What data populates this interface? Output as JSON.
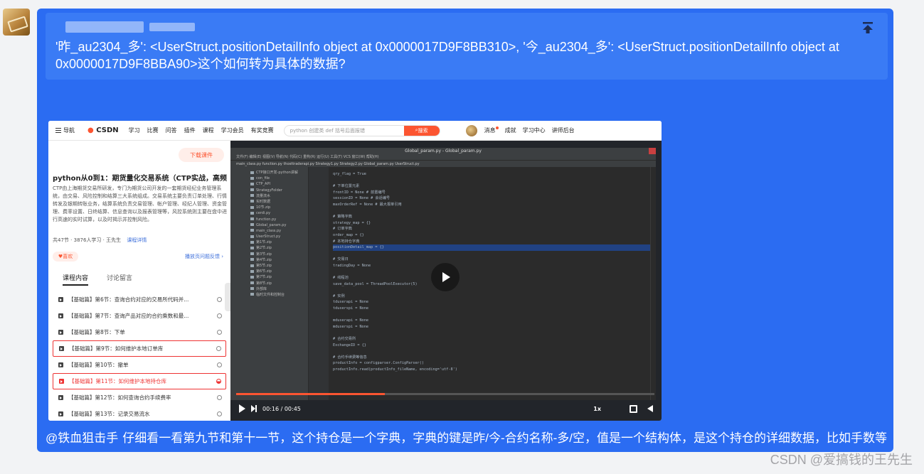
{
  "quote": {
    "text": "'昨_au2304_多': <UserStruct.positionDetailInfo object at 0x0000017D9F8BB310>, '今_au2304_多': <UserStruct.positionDetailInfo object at 0x0000017D9F8BBA90>这个如何转为具体的数据?"
  },
  "message": {
    "mention": "@铁血狙击手",
    "text": "仔细看一看第九节和第十一节，这个持仓是一个字典，字典的键是昨/今-合约名称-多/空，值是一个结构体，是这个持仓的详细数据，比如手数等"
  },
  "watermark": "CSDN @爱搞钱的王先生",
  "screenshot": {
    "nav": {
      "menu": "导航",
      "logo": "CSDN",
      "links": [
        "学习",
        "比赛",
        "问答",
        "插件",
        "课程",
        "学习会员",
        "有奖竞赛"
      ],
      "search_placeholder": "python 创建类 def 括号后面报错",
      "search_button": "搜索",
      "right": [
        "消息",
        "成就",
        "学习中心",
        "讲师后台"
      ]
    },
    "course": {
      "download": "下载课件",
      "title": "python从0到1：期货量化交易系统（CTP实战，高频...",
      "desc": "CTP由上海期货交易所研发，专门为期货公司开发的一套期货经纪业务管理系统，由交易、风险控制和结算三大系统组成。交易系统主要负责订单处理、行情转发及银期转账业务，结算系统负责交易管理、帐户管理、经纪人管理、资金管理、费率设置、日终结算、信息查询以及报表管理等，风控系统则主要在盘中进行高速的实时试算，以及时揭示并控制风险。",
      "lessons_count": "共47节",
      "students": "3876人学习",
      "teacher": "王先生",
      "detail_link": "课程详情",
      "like": "喜欢",
      "feedback": "播放页问题反馈",
      "tabs": [
        "课程内容",
        "讨论留言"
      ],
      "lessons": [
        {
          "name": "【基础篇】第6节：查询合约对应的交易所代码并..."
        },
        {
          "name": "【基础篇】第7节：查询产品对应的合约乘数和最..."
        },
        {
          "name": "【基础篇】第8节：下单"
        },
        {
          "name": "【基础篇】第9节：如何维护本地订单库"
        },
        {
          "name": "【基础篇】第10节：撤单"
        },
        {
          "name": "【基础篇】第11节：如何维护本地持仓库"
        },
        {
          "name": "【基础篇】第12节：如何查询合约手续费率"
        },
        {
          "name": "【基础篇】第13节：记录交易流水"
        }
      ]
    },
    "video": {
      "ide_title": "Global_param.py - Global_param.py",
      "menu": "文件(F)  编辑(E)  视图(V)  导航(N)  代码(C)  重构(R)  运行(U)  工具(T)  VCS  窗口(W)  帮助(H)",
      "tabs": "main_class.py   function.py   thosttraderapi.py   Strategy1.py   Strategy2.py   Global_param.py   UserStruct.py",
      "tree": [
        "CTP接口开发-python讲解",
        "con_file",
        "CTP_API",
        "StrategyFolder",
        "流量流水",
        "实时数据",
        "10节.zip",
        "cerdi.py",
        "function.py",
        "Global_param.py",
        "main_class.py",
        "UserStruct.py",
        "第1节.zip",
        "第2节.zip",
        "第3节.zip",
        "第4节.zip",
        "第5节.zip",
        "第6节.zip",
        "第7节.zip",
        "第8节.zip",
        "外部库",
        "临时文件和控制台"
      ],
      "code": [
        "qry_flag = True",
        "",
        "# 下单位置元素",
        "frontID = None   # 前置编号",
        "sessionID = None   # 会话编号",
        "maxOrderRef = None   # 最大报单引用",
        "",
        "# 策略字典",
        "strategy_map = {}",
        "# 订单字典",
        "order_map = {}",
        "# 本地持仓字典",
        "positionDetail_map = {}",
        "",
        "# 交易日",
        "tradingDay = None",
        "",
        "# 线程池",
        "save_data_pool = ThreadPoolExecutor(5)",
        "",
        "# 实例",
        "tduserapi = None",
        "tduserspi = None",
        "",
        "mduserapi = None",
        "mduserspi = None",
        "",
        "# 合约交易所",
        "ExchangeID = {}",
        "",
        "# 合约手续费等信息",
        "productInfo = configparser.ConfigParser()",
        "productInfo.read(productInfo_fileName, encoding='utf-8')"
      ],
      "highlight_line": 12,
      "time": "00:16 / 00:45",
      "progress": 0.356,
      "speed": "1x"
    }
  }
}
